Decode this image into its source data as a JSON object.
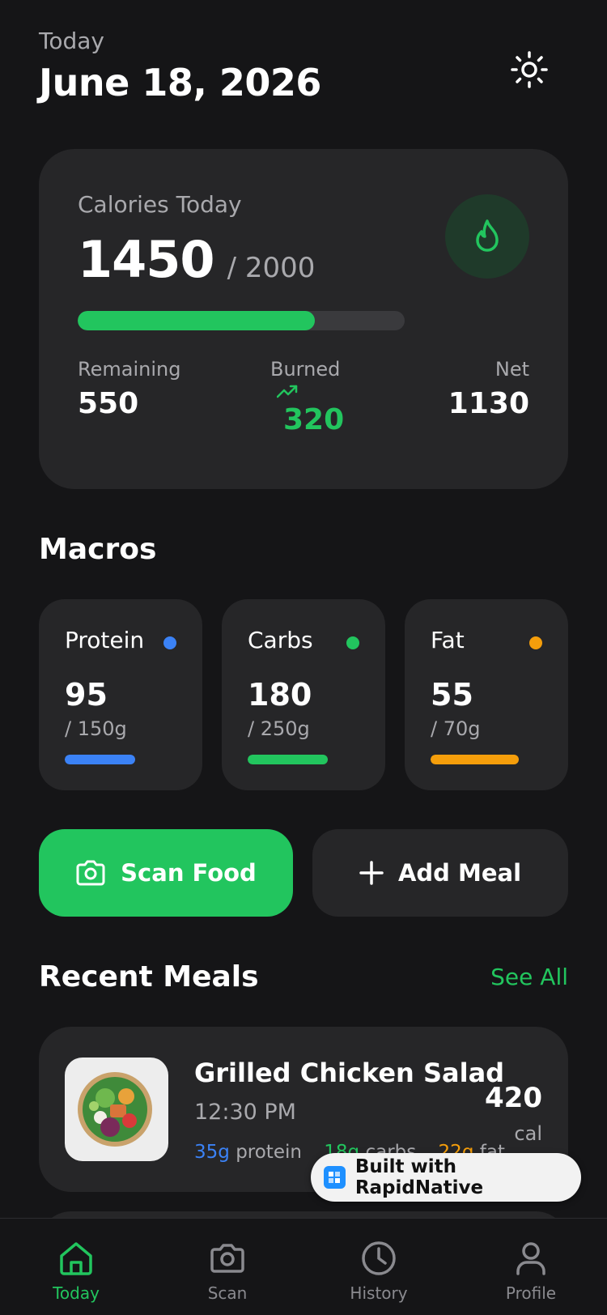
{
  "header": {
    "subtitle": "Today",
    "date": "June 18, 2026"
  },
  "calories": {
    "label": "Calories Today",
    "consumed": "1450",
    "goal": "/ 2000",
    "progress": 0.725,
    "remaining_label": "Remaining",
    "remaining": "550",
    "burned_label": "Burned",
    "burned": "320",
    "net_label": "Net",
    "net": "1130"
  },
  "macros": {
    "title": "Macros",
    "items": [
      {
        "label": "Protein",
        "value": "95",
        "goal": "/ 150g",
        "color": "#3b82f6",
        "progress": 0.63
      },
      {
        "label": "Carbs",
        "value": "180",
        "goal": "/ 250g",
        "color": "#22c55e",
        "progress": 0.72
      },
      {
        "label": "Fat",
        "value": "55",
        "goal": "/ 70g",
        "color": "#f59e0b",
        "progress": 0.79
      }
    ]
  },
  "actions": {
    "scan": "Scan Food",
    "add": "Add Meal"
  },
  "recent": {
    "title": "Recent Meals",
    "see_all": "See All",
    "meals": [
      {
        "name": "Grilled Chicken Salad",
        "time": "12:30 PM",
        "protein_value": "35g",
        "protein_label": "protein",
        "carbs_value": "18g",
        "carbs_label": "carbs",
        "fat_value": "22g",
        "fat_label": "fat",
        "calories": "420",
        "unit": "cal"
      }
    ]
  },
  "badge": {
    "label": "Built with RapidNative"
  },
  "tabs": [
    {
      "label": "Today",
      "icon": "home-icon",
      "active": true
    },
    {
      "label": "Scan",
      "icon": "camera-icon",
      "active": false
    },
    {
      "label": "History",
      "icon": "clock-icon",
      "active": false
    },
    {
      "label": "Profile",
      "icon": "user-icon",
      "active": false
    }
  ],
  "colors": {
    "accent": "#22c55e",
    "background": "#151517",
    "card": "#262628"
  }
}
